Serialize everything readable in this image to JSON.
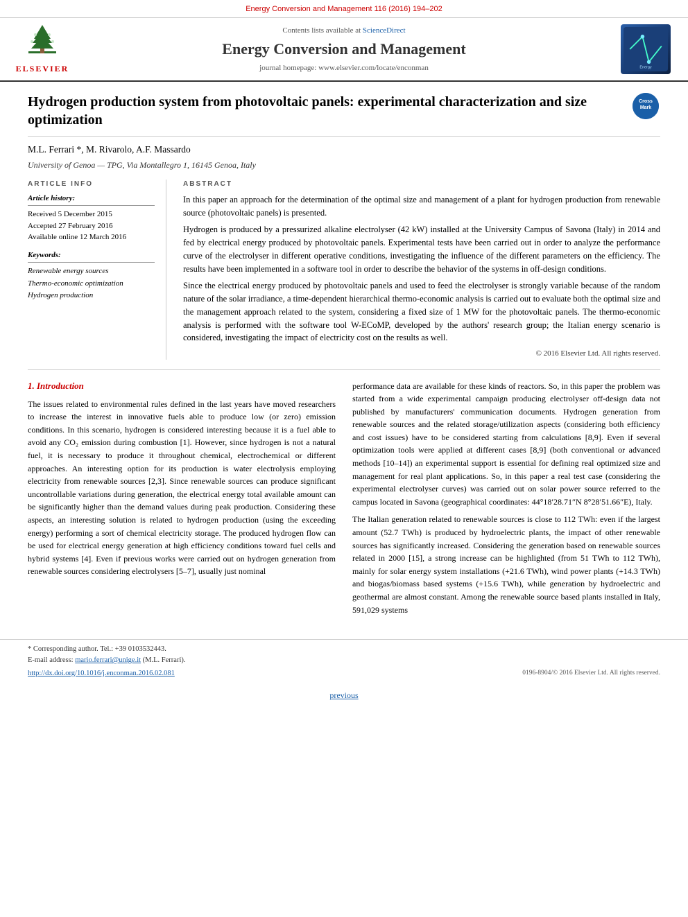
{
  "top_bar": {
    "text": "Energy Conversion and Management 116 (2016) 194–202"
  },
  "header": {
    "science_direct_label": "Contents lists available at",
    "science_direct_link": "ScienceDirect",
    "journal_title": "Energy Conversion and Management",
    "homepage_label": "journal homepage: www.elsevier.com/locate/enconman",
    "elsevier_label": "ELSEVIER"
  },
  "article": {
    "title": "Hydrogen production system from photovoltaic panels: experimental characterization and size optimization",
    "authors": "M.L. Ferrari *, M. Rivarolo, A.F. Massardo",
    "affiliation": "University of Genoa — TPG, Via Montallegro 1, 16145 Genoa, Italy",
    "info": {
      "article_info_label": "ARTICLE INFO",
      "history_label": "Article history:",
      "received": "Received 5 December 2015",
      "accepted": "Accepted 27 February 2016",
      "available": "Available online 12 March 2016",
      "keywords_label": "Keywords:",
      "keyword1": "Renewable energy sources",
      "keyword2": "Thermo-economic optimization",
      "keyword3": "Hydrogen production"
    },
    "abstract": {
      "label": "ABSTRACT",
      "para1": "In this paper an approach for the determination of the optimal size and management of a plant for hydrogen production from renewable source (photovoltaic panels) is presented.",
      "para2": "Hydrogen is produced by a pressurized alkaline electrolyser (42 kW) installed at the University Campus of Savona (Italy) in 2014 and fed by electrical energy produced by photovoltaic panels. Experimental tests have been carried out in order to analyze the performance curve of the electrolyser in different operative conditions, investigating the influence of the different parameters on the efficiency. The results have been implemented in a software tool in order to describe the behavior of the systems in off-design conditions.",
      "para3": "Since the electrical energy produced by photovoltaic panels and used to feed the electrolyser is strongly variable because of the random nature of the solar irradiance, a time-dependent hierarchical thermo-economic analysis is carried out to evaluate both the optimal size and the management approach related to the system, considering a fixed size of 1 MW for the photovoltaic panels. The thermo-economic analysis is performed with the software tool W-ECoMP, developed by the authors' research group; the Italian energy scenario is considered, investigating the impact of electricity cost on the results as well.",
      "copyright": "© 2016 Elsevier Ltd. All rights reserved."
    }
  },
  "section1": {
    "number": "1.",
    "title": "Introduction",
    "left_paragraphs": [
      "The issues related to environmental rules defined in the last years have moved researchers to increase the interest in innovative fuels able to produce low (or zero) emission conditions. In this scenario, hydrogen is considered interesting because it is a fuel able to avoid any CO₂ emission during combustion [1]. However, since hydrogen is not a natural fuel, it is necessary to produce it throughout chemical, electrochemical or different approaches. An interesting option for its production is water electrolysis employing electricity from renewable sources [2,3]. Since renewable sources can produce significant uncontrollable variations during generation, the electrical energy total available amount can be significantly higher than the demand values during peak production. Considering these aspects, an interesting solution is related to hydrogen production (using the exceeding energy) performing a sort of chemical electricity storage. The produced hydrogen flow can be used for electrical energy generation at high efficiency conditions toward fuel cells and hybrid systems [4]. Even if previous works were carried out on hydrogen generation from renewable sources considering electrolysers [5–7], usually just nominal",
      "performance data are available for these kinds of reactors. So, in this paper the problem was started from a wide experimental campaign producing electrolyser off-design data not published by manufacturers' communication documents. Hydrogen generation from renewable sources and the related storage/utilization aspects (considering both efficiency and cost issues) have to be considered starting from calculations [8,9]. Even if several optimization tools were applied at different cases [8,9] (both conventional or advanced methods [10–14]) an experimental support is essential for defining real optimized size and management for real plant applications. So, in this paper a real test case (considering the experimental electrolyser curves) was carried out on solar power source referred to the campus located in Savona (geographical coordinates: 44°18′28.71″N 8°28′51.66″E), Italy.",
      "The Italian generation related to renewable sources is close to 112 TWh: even if the largest amount (52.7 TWh) is produced by hydroelectric plants, the impact of other renewable sources has significantly increased. Considering the generation based on renewable sources related in 2000 [15], a strong increase can be highlighted (from 51 TWh to 112 TWh), mainly for solar energy system installations (+21.6 TWh), wind power plants (+14.3 TWh) and biogas/biomass based systems (+15.6 TWh), while generation by hydroelectric and geothermal are almost constant. Among the renewable source based plants installed in Italy, 591,029 systems"
    ]
  },
  "footer": {
    "corresponding_note": "* Corresponding author. Tel.: +39 0103532443.",
    "email_label": "E-mail address:",
    "email": "mario.ferrari@unige.it",
    "email_author": "(M.L. Ferrari).",
    "doi_link": "http://dx.doi.org/10.1016/j.enconman.2016.02.081",
    "issn": "0196-8904/© 2016 Elsevier Ltd. All rights reserved."
  },
  "navigation": {
    "previous_label": "previous"
  }
}
